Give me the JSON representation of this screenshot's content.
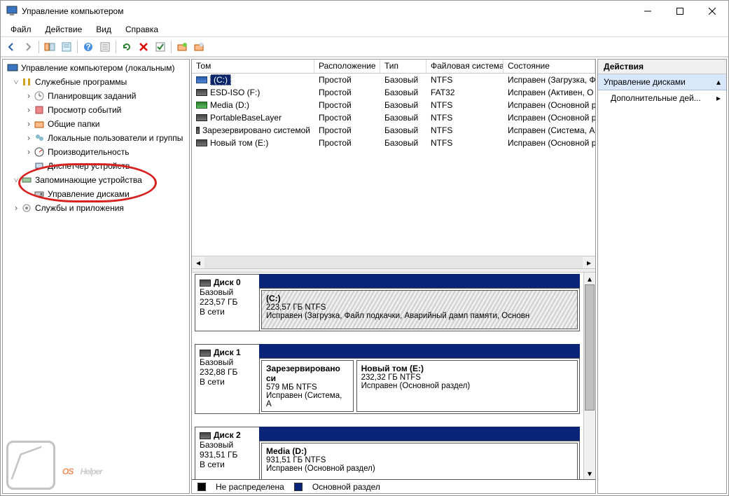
{
  "window": {
    "title": "Управление компьютером"
  },
  "menu": {
    "file": "Файл",
    "action": "Действие",
    "view": "Вид",
    "help": "Справка"
  },
  "tree": {
    "root": "Управление компьютером (локальным)",
    "g1": "Служебные программы",
    "g1a": "Планировщик заданий",
    "g1b": "Просмотр событий",
    "g1c": "Общие папки",
    "g1d": "Локальные пользователи и группы",
    "g1e": "Производительность",
    "g1f": "Диспетчер устройств",
    "g2": "Запоминающие устройства",
    "g2a": "Управление дисками",
    "g3": "Службы и приложения"
  },
  "volcols": {
    "name": "Том",
    "layout": "Расположение",
    "type": "Тип",
    "fs": "Файловая система",
    "status": "Состояние"
  },
  "vols": [
    {
      "name": "(C:)",
      "layout": "Простой",
      "type": "Базовый",
      "fs": "NTFS",
      "status": "Исправен (Загрузка, Ф",
      "icon": "blue",
      "sel": true
    },
    {
      "name": "ESD-ISO (F:)",
      "layout": "Простой",
      "type": "Базовый",
      "fs": "FAT32",
      "status": "Исправен (Активен, О",
      "icon": "dark"
    },
    {
      "name": "Media (D:)",
      "layout": "Простой",
      "type": "Базовый",
      "fs": "NTFS",
      "status": "Исправен (Основной р",
      "icon": "green"
    },
    {
      "name": "PortableBaseLayer",
      "layout": "Простой",
      "type": "Базовый",
      "fs": "NTFS",
      "status": "Исправен (Основной р",
      "icon": "dark"
    },
    {
      "name": "Зарезервировано системой",
      "layout": "Простой",
      "type": "Базовый",
      "fs": "NTFS",
      "status": "Исправен (Система, А",
      "icon": "dark"
    },
    {
      "name": "Новый том (E:)",
      "layout": "Простой",
      "type": "Базовый",
      "fs": "NTFS",
      "status": "Исправен (Основной р",
      "icon": "dark"
    }
  ],
  "disks": [
    {
      "name": "Диск 0",
      "type": "Базовый",
      "size": "223,57 ГБ",
      "status": "В сети",
      "parts": [
        {
          "label": "(C:)",
          "info": "223,57 ГБ NTFS",
          "detail": "Исправен (Загрузка, Файл подкачки, Аварийный дамп памяти, Основн",
          "striped": true,
          "flex": 1
        }
      ]
    },
    {
      "name": "Диск 1",
      "type": "Базовый",
      "size": "232,88 ГБ",
      "status": "В сети",
      "parts": [
        {
          "label": "Зарезервировано си",
          "info": "579 МБ NTFS",
          "detail": "Исправен (Система, А",
          "flex": 0.28
        },
        {
          "label": "Новый том  (E:)",
          "info": "232,32 ГБ NTFS",
          "detail": "Исправен (Основной раздел)",
          "flex": 0.72
        }
      ]
    },
    {
      "name": "Диск 2",
      "type": "Базовый",
      "size": "931,51 ГБ",
      "status": "В сети",
      "parts": [
        {
          "label": "Media  (D:)",
          "info": "931,51 ГБ NTFS",
          "detail": "Исправен (Основной раздел)",
          "flex": 1
        }
      ]
    }
  ],
  "legend": {
    "unalloc": "Не распределена",
    "primary": "Основной раздел"
  },
  "actions": {
    "header": "Действия",
    "section": "Управление дисками",
    "more": "Дополнительные дей..."
  }
}
